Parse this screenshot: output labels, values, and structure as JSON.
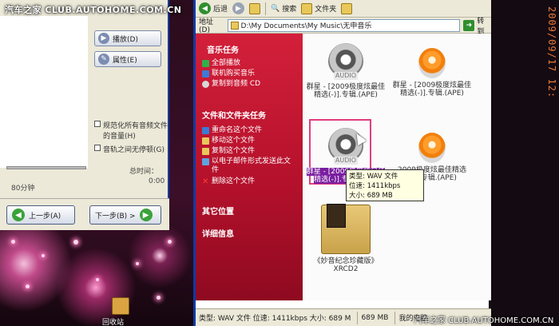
{
  "watermark": {
    "top_left": "汽车之家 CLUB.AUTOHOME.COM.CN",
    "bottom_right": "汽车之家 CLUB.AUTOHOME.COM.CN",
    "date": "2009/09/17 12:"
  },
  "wizard": {
    "play_label": "播放(D)",
    "properties_label": "属性(E)",
    "normalize_label": "规范化所有音频文件的音量(H)",
    "nogap_label": "音轨之间无停顿(G)",
    "total_time_label": "总时间：",
    "total_time_value": "0:00",
    "slider_label": "80分钟",
    "back_label": "上一步(A)",
    "next_label": "下一步(B) >"
  },
  "desktop": {
    "trash_label": "回收站"
  },
  "explorer": {
    "toolbar": {
      "back": "后退",
      "search": "搜索",
      "folders": "文件夹"
    },
    "address": {
      "label": "地址(D)",
      "path": "D:\\My Documents\\My Music\\无申音乐",
      "go": "转到"
    },
    "taskpane": {
      "music_tasks_title": "音乐任务",
      "music_tasks": [
        "全部播放",
        "联机购买音乐",
        "复制到音频 CD"
      ],
      "file_tasks_title": "文件和文件夹任务",
      "file_tasks": [
        "重命名这个文件",
        "移动这个文件",
        "复制这个文件",
        "以电子邮件形式发送此文件",
        "删除这个文件"
      ],
      "other_places": "其它位置",
      "details": "详细信息"
    },
    "files": [
      {
        "name": "群星 - [2009极度炫最佳精选(-)].专辑.(APE)",
        "icon": "audio-icon",
        "tag": "AUDIO"
      },
      {
        "name": "群星 - [2009极度炫最佳精选(-)].专辑.(APE)",
        "icon": "wmp-icon"
      },
      {
        "name": "群星 - [2009极度炫最佳精选(-)].专辑.(APE)",
        "icon": "audio-icon",
        "tag": "AUDIO",
        "selected": true
      },
      {
        "name": "2009极度炫最佳精选(-)].专辑.(APE)",
        "icon": "wmp-icon"
      },
      {
        "name": "《妙音纪念珍藏版》XRCD2",
        "icon": "folder-icon"
      }
    ],
    "tooltip": {
      "type": "类型: WAV 文件",
      "bitrate": "位速: 1411kbps",
      "size": "大小: 689 MB"
    },
    "statusbar": {
      "text": "类型: WAV 文件 位速: 1411kbps 大小: 689 M",
      "size": "689 MB",
      "location": "我的电脑"
    }
  }
}
